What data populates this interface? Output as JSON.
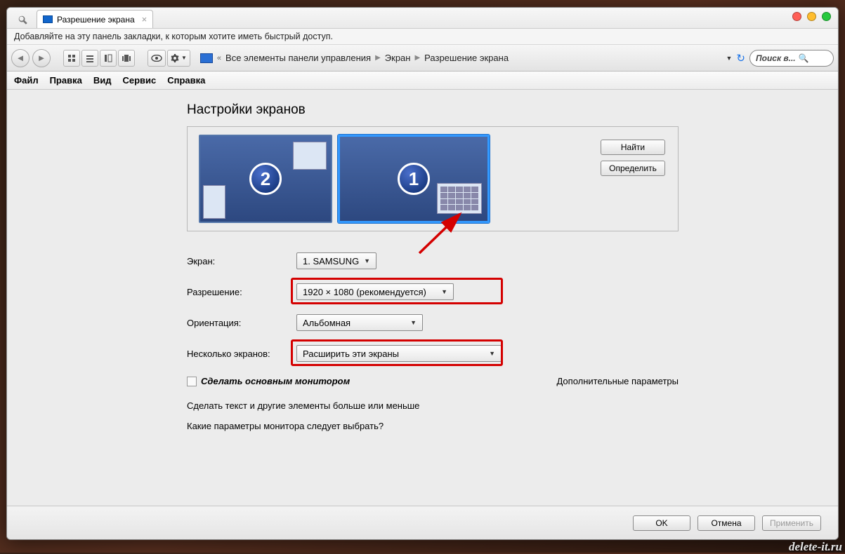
{
  "tab": {
    "title": "Разрешение экрана"
  },
  "infobar": "Добавляйте на эту панель закладки, к которым хотите иметь быстрый доступ.",
  "breadcrumb": {
    "item1": "Все элементы панели управления",
    "item2": "Экран",
    "item3": "Разрешение экрана"
  },
  "search": {
    "placeholder": "Поиск в..."
  },
  "menu": {
    "file": "Файл",
    "edit": "Правка",
    "view": "Вид",
    "service": "Сервис",
    "help": "Справка"
  },
  "page": {
    "title": "Настройки экранов",
    "monitor1_num": "1",
    "monitor2_num": "2",
    "find_btn": "Найти",
    "identify_btn": "Определить",
    "fields": {
      "screen_lbl": "Экран:",
      "screen_val": "1. SAMSUNG",
      "res_lbl": "Разрешение:",
      "res_val": "1920 × 1080 (рекомендуется)",
      "orient_lbl": "Ориентация:",
      "orient_val": "Альбомная",
      "multi_lbl": "Несколько экранов:",
      "multi_val": "Расширить эти экраны"
    },
    "make_main": "Сделать основным монитором",
    "adv_params": "Дополнительные параметры",
    "link1": "Сделать текст и другие элементы больше или меньше",
    "link2": "Какие параметры монитора следует выбрать?"
  },
  "buttons": {
    "ok": "OK",
    "cancel": "Отмена",
    "apply": "Применить"
  },
  "watermark": "delete-it.ru"
}
